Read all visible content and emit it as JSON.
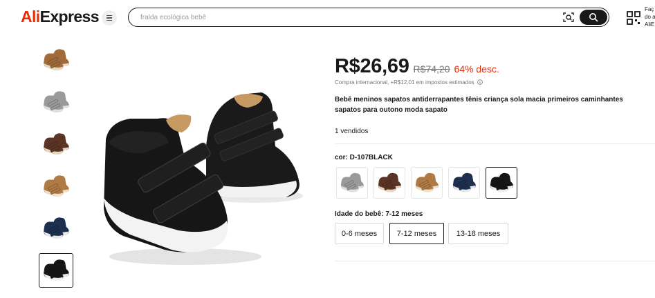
{
  "header": {
    "logo": {
      "part_a": "Ali",
      "part_b": "Express"
    },
    "search": {
      "placeholder": "fralda ecológica bebê"
    },
    "right_text": [
      "Faç",
      "do a",
      "AliE"
    ],
    "icons": [
      "menu-icon",
      "camera-search-icon",
      "search-icon",
      "qr-code-icon"
    ]
  },
  "gallery": {
    "thumbnails": [
      {
        "color": "#a06a3a",
        "accent": "#e8d8c0"
      },
      {
        "color": "#9a9a9a",
        "accent": "#e0e0e0"
      },
      {
        "color": "#5a3526",
        "accent": "#e8d8c0"
      },
      {
        "color": "#b07a45",
        "accent": "#eee2cc"
      },
      {
        "color": "#1e2f4f",
        "accent": "#e8e8e8"
      },
      {
        "color": "#151515",
        "accent": "#eeeeee"
      }
    ],
    "active_index": 5
  },
  "product": {
    "price": "R$26,69",
    "old_price": "R$74,20",
    "discount": "64% desc.",
    "tax_note": "Compra internacional, +R$12,01 em impostos estimados",
    "title": "Bebê meninos sapatos antiderrapantes tênis criança sola macia primeiros caminhantes sapatos para outono moda sapato",
    "sold": "1 vendidos",
    "color_label": "cor: D-107BLACK",
    "color_swatches": [
      {
        "color": "#9a9a9a",
        "accent": "#e0e0e0"
      },
      {
        "color": "#5a3526",
        "accent": "#e8d8c0"
      },
      {
        "color": "#b07a45",
        "accent": "#eee2cc"
      },
      {
        "color": "#1e2f4f",
        "accent": "#e8e8e8"
      },
      {
        "color": "#151515",
        "accent": "#eeeeee"
      }
    ],
    "selected_color_index": 4,
    "size_label": "Idade do bebê: 7-12 meses",
    "sizes": [
      "0-6 meses",
      "7-12 meses",
      "13-18 meses"
    ],
    "selected_size_index": 1
  },
  "colors": {
    "brand_red": "#e62e04",
    "text": "#191919",
    "muted": "#757575"
  }
}
